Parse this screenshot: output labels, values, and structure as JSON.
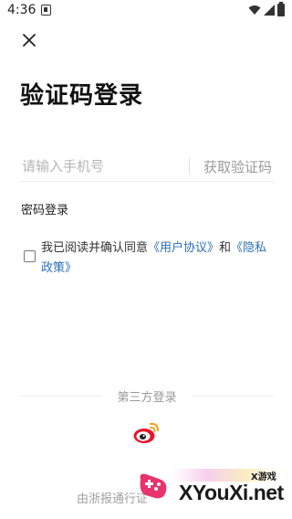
{
  "status_bar": {
    "time": "4:36"
  },
  "icons": {
    "close": "close-icon",
    "weibo": "weibo-icon",
    "notification": "notification-icon",
    "wifi": "wifi-icon",
    "signal": "signal-icon",
    "battery": "battery-icon"
  },
  "page": {
    "title": "验证码登录"
  },
  "form": {
    "phone_placeholder": "请输入手机号",
    "phone_value": "",
    "get_code_label": "获取验证码",
    "password_login_label": "密码登录",
    "agree_checked": false,
    "agree_prefix": "我已阅读并确认同意",
    "user_agreement_link": "《用户协议》",
    "agree_and": "和",
    "privacy_link": "《隐私政策》"
  },
  "third_party": {
    "label": "第三方登录"
  },
  "footer": {
    "text": "由浙报通行证"
  },
  "watermark": {
    "text": "XYouXi.net",
    "tag": "X游戏"
  },
  "colors": {
    "link": "#2b6fb6",
    "weibo_red": "#e6162d",
    "weibo_orange": "#f5a623",
    "muted_text": "#9a9a9a"
  }
}
